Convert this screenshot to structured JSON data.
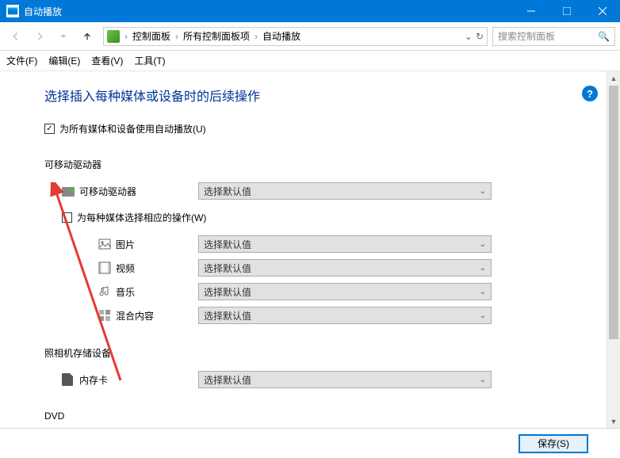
{
  "window": {
    "title": "自动播放"
  },
  "winbuttons": {
    "min": "—",
    "max": "☐",
    "close": "✕"
  },
  "breadcrumb": {
    "sep": "›",
    "items": [
      "控制面板",
      "所有控制面板项",
      "自动播放"
    ]
  },
  "search": {
    "placeholder": "搜索控制面板"
  },
  "menubar": {
    "file": "文件(F)",
    "edit": "编辑(E)",
    "view": "查看(V)",
    "tools": "工具(T)"
  },
  "page": {
    "heading": "选择插入每种媒体或设备时的后续操作",
    "help": "?",
    "useAutoplay": {
      "label": "为所有媒体和设备使用自动播放(U)",
      "checked": true
    },
    "sectionRemovable": "可移动驱动器",
    "removableDrive": {
      "label": "可移动驱动器",
      "value": "选择默认值"
    },
    "perMedia": {
      "label": "为每种媒体选择相应的操作(W)",
      "checked": false
    },
    "media": {
      "pictures": {
        "label": "图片",
        "value": "选择默认值"
      },
      "videos": {
        "label": "视频",
        "value": "选择默认值"
      },
      "music": {
        "label": "音乐",
        "value": "选择默认值"
      },
      "mixed": {
        "label": "混合内容",
        "value": "选择默认值"
      }
    },
    "sectionCamera": "照相机存储设备",
    "memoryCard": {
      "label": "内存卡",
      "value": "选择默认值"
    },
    "sectionDVD": "DVD"
  },
  "footer": {
    "save": "保存(S)"
  }
}
